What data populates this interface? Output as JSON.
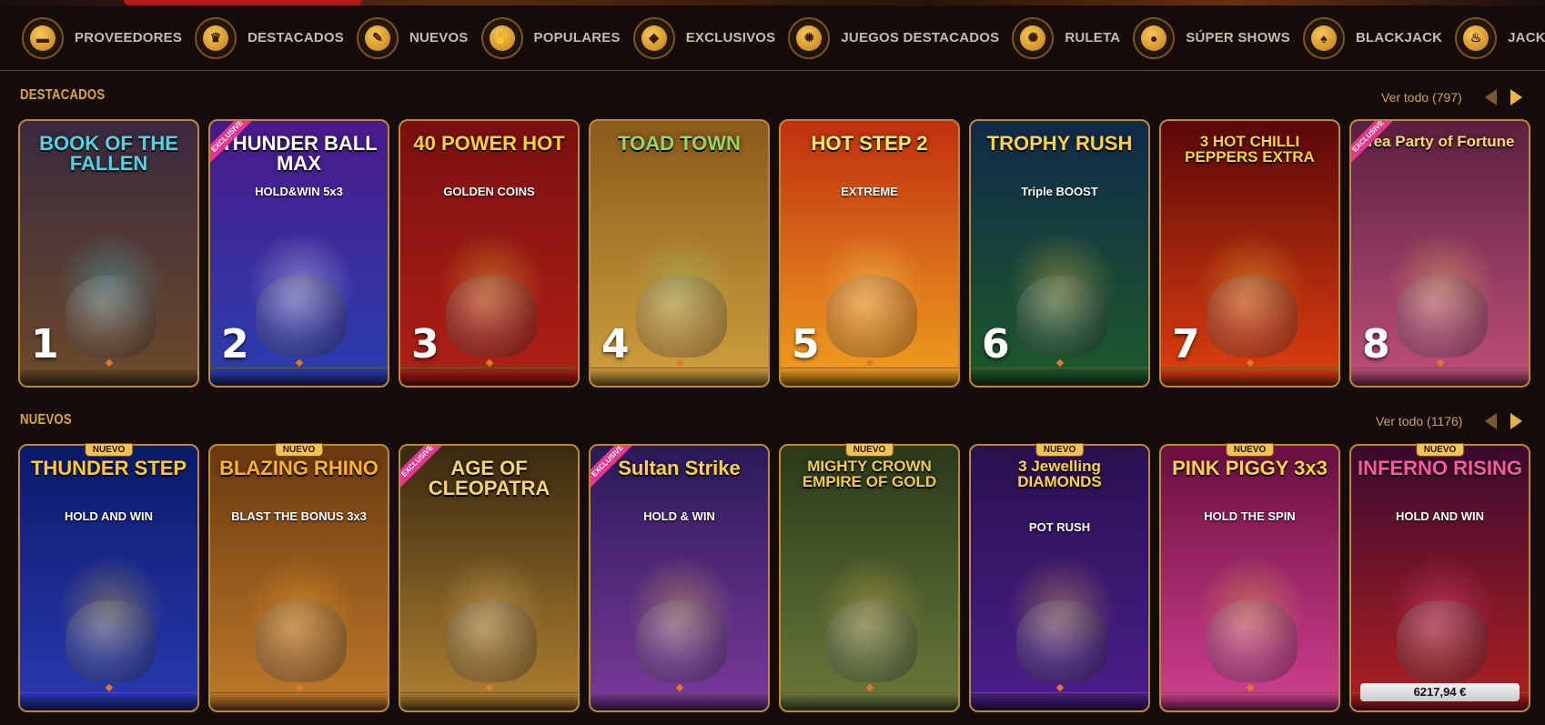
{
  "categories": [
    {
      "label": "PROVEEDORES",
      "icon": "folder-icon",
      "glyph": "▬"
    },
    {
      "label": "DESTACADOS",
      "icon": "crown-icon",
      "glyph": "♛"
    },
    {
      "label": "NUEVOS",
      "icon": "tag-icon",
      "glyph": "✎"
    },
    {
      "label": "POPULARES",
      "icon": "thumbs-up-icon",
      "glyph": "✋"
    },
    {
      "label": "EXCLUSIVOS",
      "icon": "diamond-icon",
      "glyph": "◆"
    },
    {
      "label": "JUEGOS DESTACADOS",
      "icon": "star-badge-icon",
      "glyph": "✹"
    },
    {
      "label": "RULETA",
      "icon": "roulette-icon",
      "glyph": "✺"
    },
    {
      "label": "SÚPER SHOWS",
      "icon": "microphone-icon",
      "glyph": "●"
    },
    {
      "label": "BLACKJACK",
      "icon": "spade-icon",
      "glyph": "♠"
    },
    {
      "label": "JACKPOTS CALI",
      "icon": "flame-icon",
      "glyph": "♨"
    }
  ],
  "destacados": {
    "title": "DESTACADOS",
    "ver_todo": "Ver todo (797)",
    "games": [
      {
        "rank": "1",
        "name": "BOOK OF THE FALLEN",
        "exclusive": false,
        "bg": [
          "#3b2a3f",
          "#6b4a2a"
        ],
        "title_color": "#4fd3e6"
      },
      {
        "rank": "2",
        "name": "THUNDER BALL MAX",
        "sub": "HOLD&WIN 5x3",
        "exclusive": true,
        "bg": [
          "#4b1a8a",
          "#2a3fb0"
        ],
        "title_color": "#ffffff"
      },
      {
        "rank": "3",
        "name": "40 POWER HOT",
        "sub": "GOLDEN COINS",
        "exclusive": false,
        "bg": [
          "#7a1010",
          "#b02015"
        ],
        "title_color": "#ffd23a"
      },
      {
        "rank": "4",
        "name": "TOAD TOWN",
        "exclusive": false,
        "bg": [
          "#8a5a1a",
          "#d0a040"
        ],
        "title_color": "#9ad36a"
      },
      {
        "rank": "5",
        "name": "HOT STEP 2",
        "sub": "EXTREME",
        "exclusive": false,
        "bg": [
          "#c03010",
          "#f0a020"
        ],
        "title_color": "#ffeb6a"
      },
      {
        "rank": "6",
        "name": "TROPHY RUSH",
        "sub": "Triple BOOST",
        "exclusive": false,
        "bg": [
          "#102a4a",
          "#1e5a2a"
        ],
        "title_color": "#ffd24a"
      },
      {
        "rank": "7",
        "name": "3 HOT CHILLI PEPPERS EXTRA",
        "exclusive": false,
        "bg": [
          "#5a0808",
          "#e04010"
        ],
        "title_color": "#ffd040"
      },
      {
        "rank": "8",
        "name": "Tea Party of Fortune",
        "exclusive": true,
        "bg": [
          "#5a2040",
          "#c0507a"
        ],
        "title_color": "#ffd86a"
      }
    ]
  },
  "nuevos": {
    "title": "NUEVOS",
    "ver_todo": "Ver todo (1176)",
    "badge": "NUEVO",
    "games": [
      {
        "name": "THUNDER STEP",
        "sub": "HOLD AND WIN",
        "badge": true,
        "exclusive": false,
        "bg": [
          "#0a1a6a",
          "#2a3ab0"
        ],
        "title_color": "#ffcc2a"
      },
      {
        "name": "BLAZING RHINO",
        "sub": "BLAST THE BONUS 3x3",
        "badge": true,
        "exclusive": false,
        "bg": [
          "#6a3a10",
          "#c07a2a"
        ],
        "title_color": "#ffb22a"
      },
      {
        "name": "AGE OF CLEOPATRA",
        "badge": false,
        "exclusive": true,
        "bg": [
          "#3a2a10",
          "#b08030"
        ],
        "title_color": "#f5d37a"
      },
      {
        "name": "Sultan Strike",
        "sub": "HOLD & WIN",
        "badge": false,
        "exclusive": true,
        "bg": [
          "#2a1a5a",
          "#7a3a9a"
        ],
        "title_color": "#ffd24a"
      },
      {
        "name": "MIGHTY CROWN EMPIRE OF GOLD",
        "badge": true,
        "exclusive": false,
        "bg": [
          "#2a3a1a",
          "#6a7a3a"
        ],
        "title_color": "#f0c85a"
      },
      {
        "name": "3 Jewelling DIAMONDS",
        "sub": "POT RUSH",
        "badge": true,
        "exclusive": false,
        "bg": [
          "#2a1050",
          "#4a208a"
        ],
        "title_color": "#ffd24a"
      },
      {
        "name": "PINK PIGGY 3x3",
        "sub": "HOLD THE SPIN",
        "badge": true,
        "exclusive": false,
        "bg": [
          "#6a1040",
          "#d04090"
        ],
        "title_color": "#ffd24a"
      },
      {
        "name": "INFERNO RISING",
        "sub": "HOLD AND WIN",
        "badge": true,
        "exclusive": false,
        "bg": [
          "#3a0a30",
          "#b02020"
        ],
        "title_color": "#ff5aa0",
        "jackpot": "6217,94 €"
      }
    ]
  },
  "exclusive_label": "EXCLUSIVE",
  "colors": {
    "accent": "#d9a748",
    "card_border": "#b98a3a",
    "bg": "#160c0c"
  }
}
